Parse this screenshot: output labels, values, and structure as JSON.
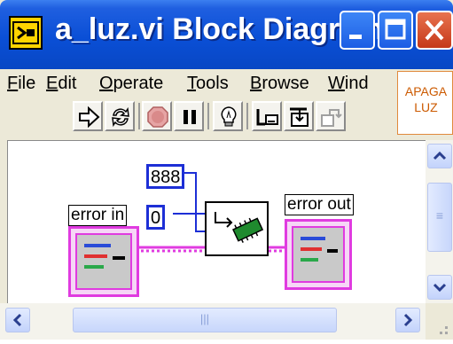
{
  "window": {
    "title": "a_luz.vi Block Diagram"
  },
  "menu": {
    "items": [
      {
        "first": "F",
        "rest": "ile"
      },
      {
        "first": "E",
        "rest": "dit"
      },
      {
        "first": "O",
        "rest": "perate"
      },
      {
        "first": "T",
        "rest": "ools"
      },
      {
        "first": "B",
        "rest": "rowse"
      },
      {
        "first": "W",
        "rest": "ind"
      }
    ]
  },
  "toolbar": {
    "buttons": [
      "run-arrow-icon",
      "run-continuously-icon",
      "abort-stop-icon",
      "pause-icon",
      "highlight-execution-icon",
      "retain-wire-values-icon",
      "step-into-icon",
      "step-over-icon"
    ]
  },
  "icon_pane": {
    "line1": "APAGA",
    "line2": "LUZ",
    "border_color": "#e08a3c",
    "text_color": "#cc5a00"
  },
  "diagram": {
    "constant_port": "888",
    "constant_value": "0",
    "error_in_label": "error in",
    "error_out_label": "error out",
    "wire_color_numeric": "#1d2fd6",
    "wire_color_cluster": "#e03be0"
  },
  "scroll": {
    "hthumb_grip": "|||",
    "vthumb_grip": "≡"
  }
}
